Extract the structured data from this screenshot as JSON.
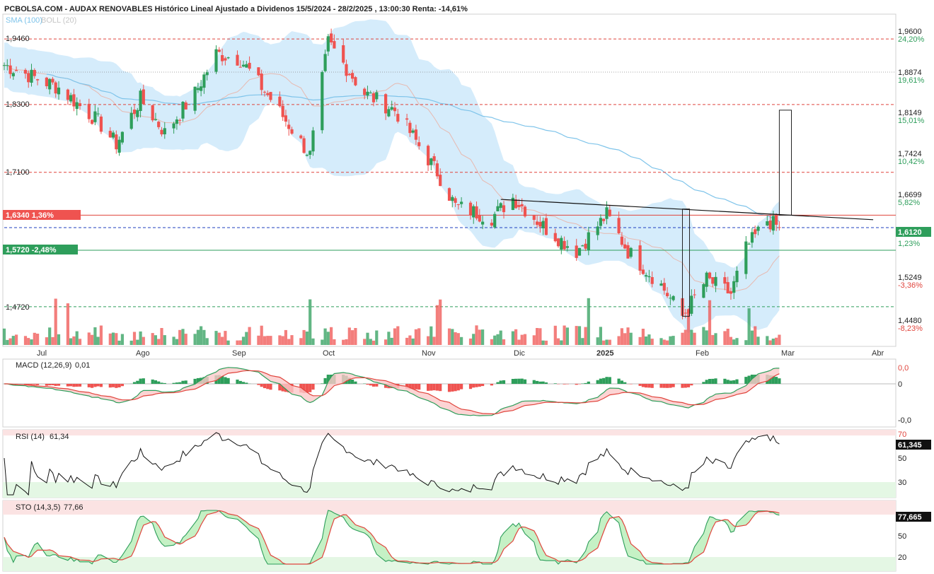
{
  "header": {
    "title": "PCBOLSA.COM - AUDAX RENOVABLES Histórico Lineal Ajustado a Dividenos 15/5/2024 - 28/2/2025 , 13:00:30 Renta: -14,61%",
    "legend_sma": "SMA (100)",
    "legend_boll": "BOLL (20)"
  },
  "colors": {
    "up": "#2e9e5b",
    "down": "#ef5350",
    "boll_fill": "#d5ecfb",
    "sma": "#7fc4ea",
    "current_tag": "#2e9e5b",
    "resist_tag": "#ef5350",
    "support_tag": "#2e9e5b",
    "overbought": "#fbe3e3",
    "oversold": "#e4f7e4"
  },
  "axis": {
    "right_prices": [
      "1,9600",
      "1,8874",
      "1,8149",
      "1,7424",
      "1,6699",
      "1,5249",
      "1,4480"
    ],
    "right_pcts": [
      "24,20%",
      "19,61%",
      "15,01%",
      "10,42%",
      "5,82%",
      "1,23%",
      "-3,36%",
      "-8,23%"
    ],
    "left_levels": [
      "1,9460",
      "1,8300",
      "1,7100",
      "1,4720"
    ],
    "current_price": "1,6120",
    "resistance_tag": "1,6340  1,36%",
    "support_tag": "1,5720  -2,48%",
    "months": [
      "Jul",
      "Ago",
      "Sep",
      "Oct",
      "Nov",
      "Dic",
      "2025",
      "Feb",
      "Mar",
      "Abr"
    ]
  },
  "macd": {
    "label": "MACD (12,26,9)",
    "value": "0,01",
    "ticks": [
      "0,0",
      "0",
      "-0,0"
    ]
  },
  "rsi": {
    "label": "RSI (14)",
    "value": "61,34",
    "ticks": [
      "70",
      "50",
      "30"
    ],
    "current": "61,345"
  },
  "sto": {
    "label": "STO (14,3,5)",
    "value": "77,66",
    "ticks": [
      "50",
      "20"
    ],
    "current": "77,665"
  },
  "chart_data": {
    "type": "candlestick",
    "title": "PCBOLSA.COM - AUDAX RENOVABLES Histórico Lineal Ajustado a Dividenos 15/5/2024 - 28/2/2025 , 13:00:30 Renta: -14,61%",
    "ylim": [
      1.43,
      1.99
    ],
    "current": 1.612,
    "keypoints": [
      {
        "date": "2024-06-17",
        "close": 1.9
      },
      {
        "date": "2024-07-05",
        "close": 1.86
      },
      {
        "date": "2024-07-18",
        "close": 1.8
      },
      {
        "date": "2024-07-24",
        "close": 1.76
      },
      {
        "date": "2024-08-01",
        "close": 1.84
      },
      {
        "date": "2024-08-09",
        "close": 1.78
      },
      {
        "date": "2024-08-19",
        "close": 1.85
      },
      {
        "date": "2024-08-26",
        "close": 1.92
      },
      {
        "date": "2024-09-03",
        "close": 1.91
      },
      {
        "date": "2024-09-13",
        "close": 1.84
      },
      {
        "date": "2024-09-26",
        "close": 1.74
      },
      {
        "date": "2024-10-02",
        "close": 1.94
      },
      {
        "date": "2024-10-14",
        "close": 1.85
      },
      {
        "date": "2024-10-24",
        "close": 1.82
      },
      {
        "date": "2024-11-07",
        "close": 1.71
      },
      {
        "date": "2024-11-13",
        "close": 1.65
      },
      {
        "date": "2024-11-25",
        "close": 1.63
      },
      {
        "date": "2024-12-02",
        "close": 1.665
      },
      {
        "date": "2024-12-13",
        "close": 1.61
      },
      {
        "date": "2024-12-23",
        "close": 1.57
      },
      {
        "date": "2025-01-02",
        "close": 1.635
      },
      {
        "date": "2025-01-09",
        "close": 1.57
      },
      {
        "date": "2025-01-20",
        "close": 1.51
      },
      {
        "date": "2025-01-27",
        "close": 1.455
      },
      {
        "date": "2025-02-04",
        "close": 1.52
      },
      {
        "date": "2025-02-12",
        "close": 1.495
      },
      {
        "date": "2025-02-17",
        "close": 1.575
      },
      {
        "date": "2025-02-24",
        "close": 1.625
      },
      {
        "date": "2025-02-28",
        "close": 1.612
      }
    ],
    "levels": [
      {
        "value": 1.946,
        "style": "dashed-red"
      },
      {
        "value": 1.83,
        "style": "dashed-red"
      },
      {
        "value": 1.71,
        "style": "dashed-red"
      },
      {
        "value": 1.634,
        "style": "solid-red"
      },
      {
        "value": 1.612,
        "style": "dashed-blue"
      },
      {
        "value": 1.572,
        "style": "solid-green"
      },
      {
        "value": 1.472,
        "style": "dashed-green"
      }
    ],
    "trendline": [
      {
        "date": "2024-11-28",
        "value": 1.662
      },
      {
        "date": "2025-03-31",
        "value": 1.626
      }
    ],
    "boxes": [
      {
        "from": "2025-01-27",
        "to": "2025-01-29",
        "low": 1.455,
        "high": 1.645
      },
      {
        "from": "2025-02-28",
        "to": "2025-03-04",
        "low": 1.634,
        "high": 1.82
      }
    ],
    "x_range": [
      "2024-06-17",
      "2025-04-07"
    ]
  }
}
